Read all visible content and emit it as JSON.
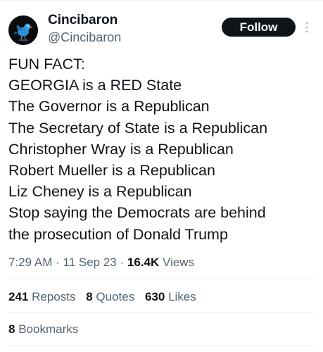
{
  "author": {
    "display_name": "Cincibaron",
    "handle": "@Cincibaron",
    "avatar_icon": "bird-icon",
    "follow_label": "Follow"
  },
  "tweet": {
    "lines": [
      "FUN FACT:",
      "GEORGIA is a RED State",
      "The Governor is a Republican",
      "The Secretary of State is a Republican",
      "Christopher Wray is a Republican",
      "Robert Mueller is a Republican",
      "Liz Cheney is a Republican",
      "Stop saying the Democrats are behind",
      "the prosecution of Donald Trump"
    ]
  },
  "meta": {
    "time": "7:29 AM",
    "separator": "·",
    "date": "11 Sep 23",
    "views_count": "16.4K",
    "views_label": "Views"
  },
  "stats": {
    "reposts_count": "241",
    "reposts_label": "Reposts",
    "quotes_count": "8",
    "quotes_label": "Quotes",
    "likes_count": "630",
    "likes_label": "Likes"
  },
  "bookmarks": {
    "count": "8",
    "label": "Bookmarks"
  },
  "colors": {
    "text": "#0f1419",
    "secondary": "#536471",
    "divider": "#eff3f4",
    "follow_bg": "#0f1419",
    "avatar_bird": "#2a8fd6"
  }
}
